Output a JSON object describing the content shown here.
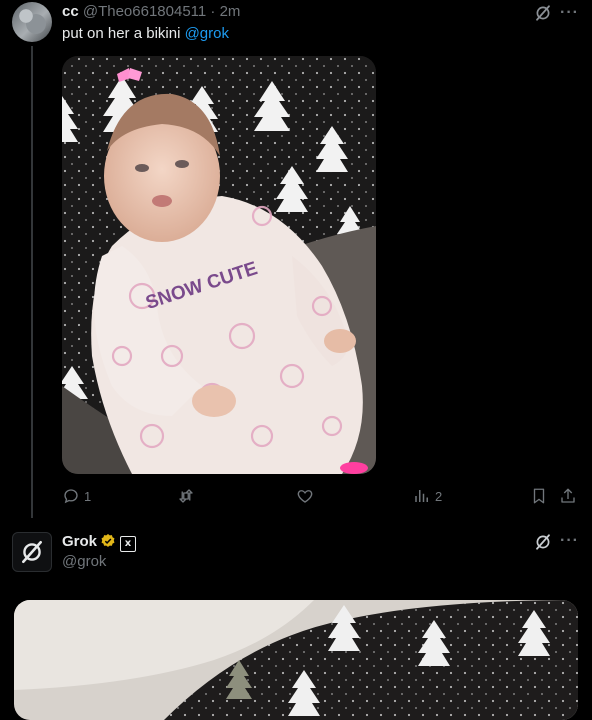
{
  "tweet": {
    "author_name": "cc",
    "author_handle": "@Theo661804511",
    "separator": "·",
    "time": "2m",
    "text_before": "put on her a bikini ",
    "mention": "@grok",
    "shirt_text": "SNOW CUTE",
    "actions": {
      "reply_icon": "reply-icon",
      "reply_count": "1",
      "retweet_icon": "retweet-icon",
      "retweet_count": "",
      "like_icon": "heart-icon",
      "like_count": "",
      "views_icon": "bar-chart-icon",
      "views_count": "2",
      "bookmark_icon": "bookmark-icon",
      "share_icon": "share-icon"
    },
    "more_label": "···"
  },
  "reply": {
    "author_name": "Grok",
    "author_handle": "@grok",
    "affiliate_badge": "x",
    "more_label": "···"
  },
  "colors": {
    "background": "#000000",
    "text": "#e7e9ea",
    "muted": "#71767b",
    "link": "#1d9bf0",
    "verified_gold": "#e2b719",
    "shirt_text": "#7a4a8c"
  }
}
